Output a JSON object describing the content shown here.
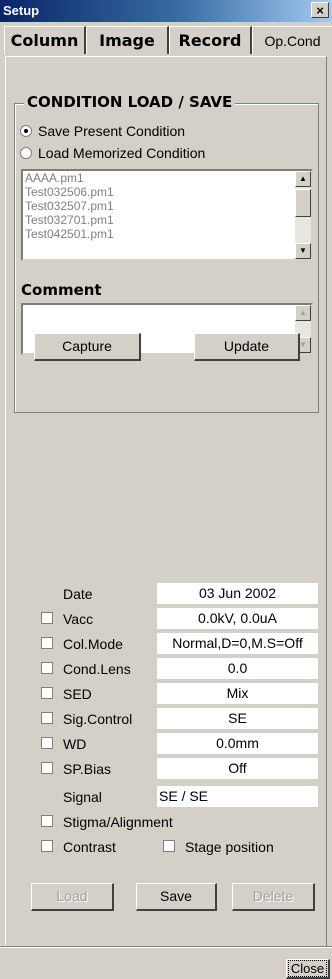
{
  "window": {
    "title": "Setup",
    "close_glyph": "×"
  },
  "tabs": [
    {
      "label": "Column"
    },
    {
      "label": "Image"
    },
    {
      "label": "Record"
    },
    {
      "label": "Op.Cond"
    }
  ],
  "condition": {
    "group_title": "CONDITION LOAD / SAVE",
    "radio_save": "Save Present Condition",
    "radio_load": "Load Memorized Condition",
    "selected_mode": "save",
    "files": [
      "AAAA.pm1",
      "Test032506.pm1",
      "Test032507.pm1",
      "Test032701.pm1",
      "Test042501.pm1"
    ],
    "comment_label": "Comment",
    "comment_value": "",
    "capture_label": "Capture",
    "update_label": "Update"
  },
  "conditions": {
    "date_label": "Date",
    "date_value": "03 Jun 2002",
    "rows": [
      {
        "label": "Vacc",
        "value": "0.0kV, 0.0uA"
      },
      {
        "label": "Col.Mode",
        "value": "Normal,D=0,M.S=Off"
      },
      {
        "label": "Cond.Lens",
        "value": "0.0"
      },
      {
        "label": "SED",
        "value": "Mix"
      },
      {
        "label": "Sig.Control",
        "value": "SE"
      },
      {
        "label": "WD",
        "value": "0.0mm"
      },
      {
        "label": "SP.Bias",
        "value": "Off"
      }
    ],
    "signal_label": "Signal",
    "signal_value": "SE / SE",
    "stigma_label": "Stigma/Alignment",
    "contrast_label": "Contrast",
    "stage_label": "Stage position"
  },
  "actions": {
    "load": "Load",
    "save": "Save",
    "delete": "Delete"
  },
  "footer": {
    "close_label": "Close"
  }
}
